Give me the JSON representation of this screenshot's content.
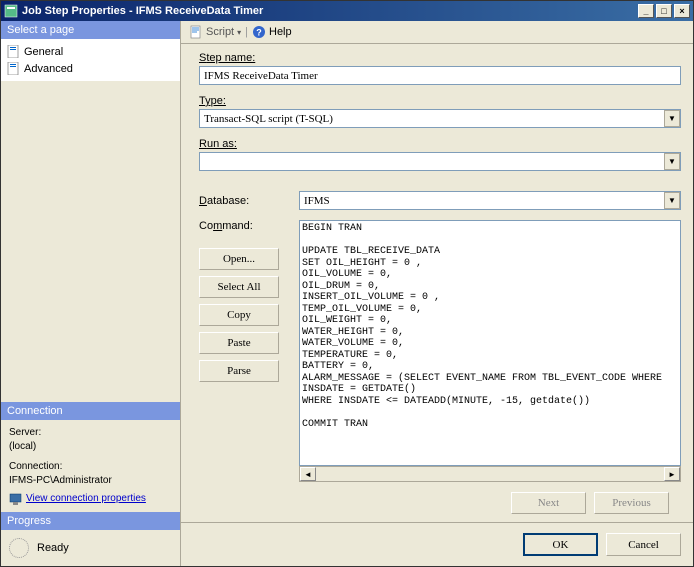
{
  "window": {
    "title": "Job Step Properties - IFMS ReceiveData Timer",
    "buttons": {
      "min": "_",
      "max": "□",
      "close": "×"
    }
  },
  "sidebar": {
    "select_page": "Select a page",
    "items": [
      {
        "label": "General"
      },
      {
        "label": "Advanced"
      }
    ],
    "connection": {
      "header": "Connection",
      "server_label": "Server:",
      "server_value": "(local)",
      "conn_label": "Connection:",
      "conn_value": "IFMS-PC\\Administrator",
      "link": "View connection properties"
    },
    "progress": {
      "header": "Progress",
      "status": "Ready"
    }
  },
  "toolbar": {
    "script": "Script",
    "help": "Help"
  },
  "form": {
    "step_name_label": "Step name:",
    "step_name_value": "IFMS ReceiveData Timer",
    "type_label": "Type:",
    "type_value": "Transact-SQL script (T-SQL)",
    "run_as_label": "Run as:",
    "run_as_value": "",
    "database_label": "Database:",
    "database_value": "IFMS",
    "command_label": "Command:",
    "command_value": "BEGIN TRAN\n\nUPDATE TBL_RECEIVE_DATA\nSET OIL_HEIGHT = 0 ,\nOIL_VOLUME = 0,\nOIL_DRUM = 0,\nINSERT_OIL_VOLUME = 0 ,\nTEMP_OIL_VOLUME = 0,\nOIL_WEIGHT = 0,\nWATER_HEIGHT = 0,\nWATER_VOLUME = 0,\nTEMPERATURE = 0,\nBATTERY = 0,\nALARM_MESSAGE = (SELECT EVENT_NAME FROM TBL_EVENT_CODE WHERE\nINSDATE = GETDATE()\nWHERE INSDATE <= DATEADD(MINUTE, -15, getdate())\n\nCOMMIT TRAN",
    "buttons": {
      "open": "Open...",
      "select_all": "Select All",
      "copy": "Copy",
      "paste": "Paste",
      "parse": "Parse"
    }
  },
  "nav": {
    "next": "Next",
    "previous": "Previous"
  },
  "footer": {
    "ok": "OK",
    "cancel": "Cancel"
  }
}
